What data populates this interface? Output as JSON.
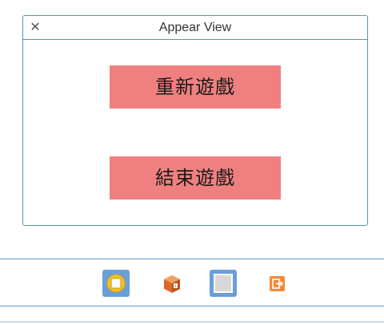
{
  "window": {
    "title": "Appear View",
    "close_glyph": "✕"
  },
  "buttons": {
    "restart_label": "重新遊戲",
    "end_label": "結束遊戲",
    "color": "#f08080"
  },
  "dock": {
    "icons": [
      {
        "name": "view-controller-icon",
        "color": "#6a9fd8"
      },
      {
        "name": "first-responder-icon",
        "color": "#e5833a"
      },
      {
        "name": "view-icon",
        "color": "#6a9fd8"
      },
      {
        "name": "exit-icon",
        "color": "#f08a3a"
      }
    ]
  },
  "accent_color": "#5b8fc7"
}
